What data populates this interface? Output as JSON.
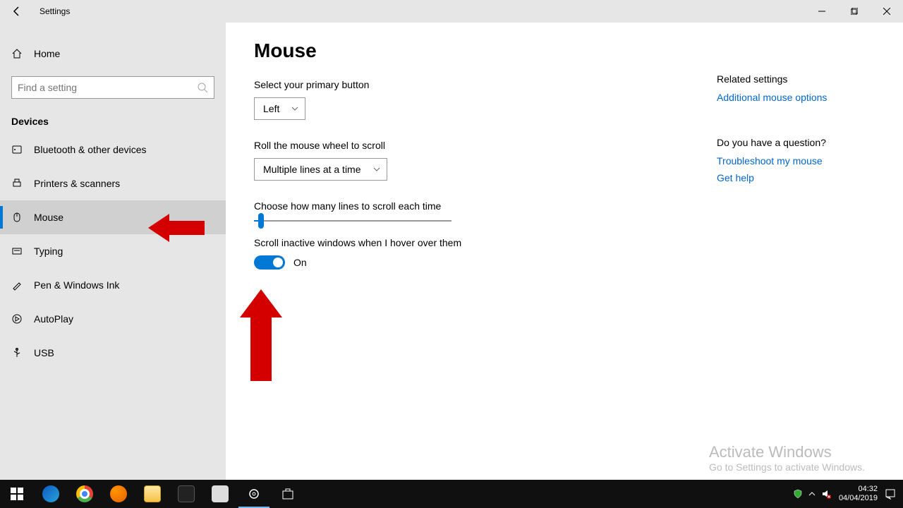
{
  "window": {
    "title": "Settings"
  },
  "sidebar": {
    "home": "Home",
    "search_placeholder": "Find a setting",
    "section": "Devices",
    "items": [
      {
        "label": "Bluetooth & other devices"
      },
      {
        "label": "Printers & scanners"
      },
      {
        "label": "Mouse"
      },
      {
        "label": "Typing"
      },
      {
        "label": "Pen & Windows Ink"
      },
      {
        "label": "AutoPlay"
      },
      {
        "label": "USB"
      }
    ]
  },
  "page": {
    "title": "Mouse",
    "primary_button_label": "Select your primary button",
    "primary_button_value": "Left",
    "roll_wheel_label": "Roll the mouse wheel to scroll",
    "roll_wheel_value": "Multiple lines at a time",
    "lines_label": "Choose how many lines to scroll each time",
    "scroll_inactive_label": "Scroll inactive windows when I hover over them",
    "toggle_state": "On"
  },
  "related": {
    "header": "Related settings",
    "link1": "Additional mouse options",
    "question_header": "Do you have a question?",
    "link2": "Troubleshoot my mouse",
    "link3": "Get help"
  },
  "activate": {
    "title": "Activate Windows",
    "sub": "Go to Settings to activate Windows."
  },
  "tray": {
    "time": "04:32",
    "date": "04/04/2019"
  }
}
